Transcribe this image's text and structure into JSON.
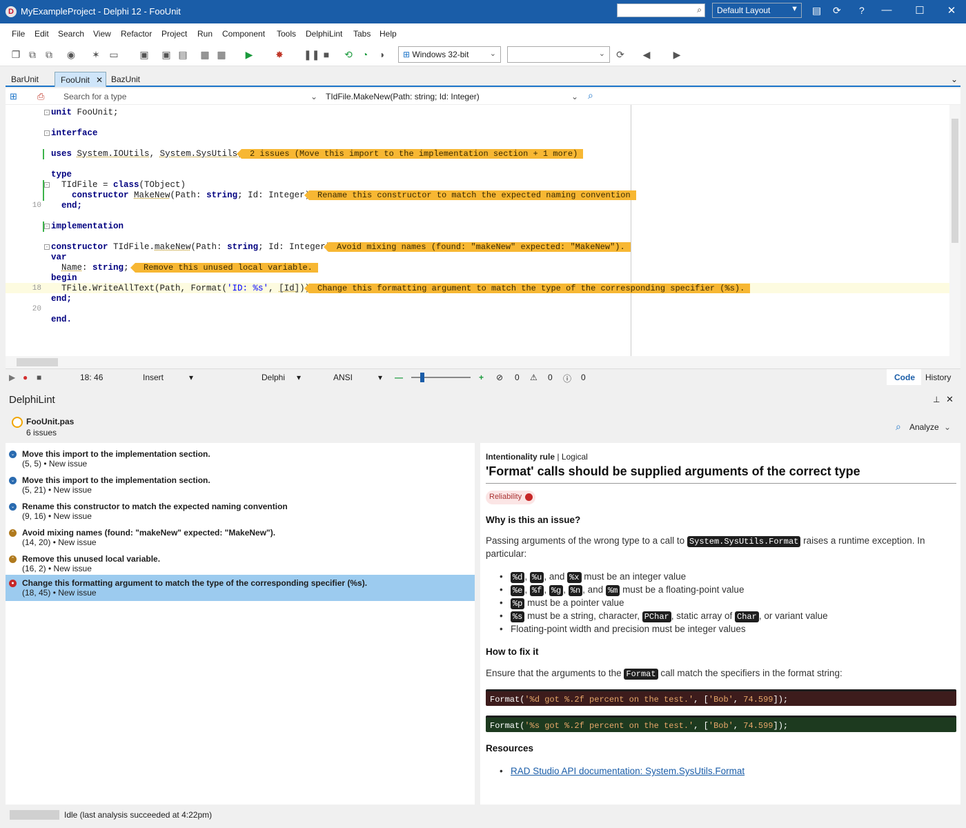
{
  "window": {
    "title": "MyExampleProject - Delphi 12 - FooUnit",
    "layout": "Default Layout",
    "help_label": "?"
  },
  "menu": [
    "File",
    "Edit",
    "Search",
    "View",
    "Refactor",
    "Project",
    "Run",
    "Component",
    "Tools",
    "DelphiLint",
    "Tabs",
    "Help"
  ],
  "toolbar": {
    "platform": "Windows 32-bit",
    "config": ""
  },
  "tabs": [
    "BarUnit",
    "FooUnit",
    "BazUnit"
  ],
  "editor_header": {
    "search_placeholder": "Search for a type",
    "method": "TIdFile.MakeNew(Path: string; Id: Integer)"
  },
  "code": {
    "l1_kw": "unit",
    "l1_rest": " FooUnit;",
    "l3": "interface",
    "l5_kw": "uses",
    "l5_a": "System.IOUtils",
    "l5_sep": ", ",
    "l5_b": "System.SysUtils",
    "l5_end": ";",
    "l7": "type",
    "l8_a": "  TIdFile = ",
    "l8_kw": "class",
    "l8_b": "(TObject)",
    "l9_kw": "    constructor ",
    "l9_name": "MakeNew",
    "l9_a": "(Path: ",
    "l9_t1": "string",
    "l9_b": "; Id: Integer);",
    "l10": "  end;",
    "l12": "implementation",
    "l14_kw": "constructor",
    "l14_a": " TIdFile.",
    "l14_name": "makeNew",
    "l14_b": "(Path: ",
    "l14_t": "string",
    "l14_c": "; Id: Integer);",
    "l15": "var",
    "l16_a": "  ",
    "l16_name": "Name",
    "l16_b": ": ",
    "l16_t": "string",
    "l16_c": ";",
    "l17": "begin",
    "l18_a": "  TFile.WriteAllText(Path, Format(",
    "l18_s": "'ID: %s'",
    "l18_b": ", ",
    "l18_arr": "[Id]",
    "l18_c": "));",
    "l19": "end;",
    "l21": "end.",
    "ln10": "10",
    "ln18": "18",
    "ln20": "20"
  },
  "inline_issues": {
    "i5": "2 issues (Move this import to the implementation section + 1 more)",
    "i9": "Rename this constructor to match the expected naming convention",
    "i14": "Avoid mixing names (found: \"makeNew\" expected: \"MakeNew\").",
    "i16": "Remove this unused local variable.",
    "i18": "Change this formatting argument to match the type of the corresponding specifier (%s)."
  },
  "status": {
    "position": "18: 46",
    "mode": "Insert",
    "language": "Delphi",
    "encoding": "ANSI",
    "errors": "0",
    "warnings": "0",
    "hints": "0",
    "code_tab": "Code",
    "history_tab": "History"
  },
  "lint": {
    "panel_title": "DelphiLint",
    "file": "FooUnit.pas",
    "count": "6 issues",
    "analyze": "Analyze",
    "issues": [
      {
        "title": "Move this import to the implementation section.",
        "meta": "(5, 5) • New issue",
        "sev": "info"
      },
      {
        "title": "Move this import to the implementation section.",
        "meta": "(5, 21) • New issue",
        "sev": "info"
      },
      {
        "title": "Rename this constructor to match the expected naming convention",
        "meta": "(9, 16) • New issue",
        "sev": "info"
      },
      {
        "title": "Avoid mixing names (found: \"makeNew\" expected: \"MakeNew\").",
        "meta": "(14, 20) • New issue",
        "sev": "minor"
      },
      {
        "title": "Remove this unused local variable.",
        "meta": "(16, 2) • New issue",
        "sev": "minor"
      },
      {
        "title": "Change this formatting argument to match the type of the corresponding specifier (%s).",
        "meta": "(18, 45) • New issue",
        "sev": "critical"
      }
    ],
    "status": "Idle (last analysis succeeded at 4:22pm)"
  },
  "detail": {
    "rule_type": "Intentionality rule",
    "rule_cat": "Logical",
    "title": "'Format' calls should be supplied arguments of the correct type",
    "badge": "Reliability",
    "why_heading": "Why is this an issue?",
    "why_1": "Passing arguments of the wrong type to a call to",
    "why_code": "System.SysUtils.Format",
    "why_2": " raises a runtime exception. In",
    "why_3": "particular:",
    "b1_c1": "%d",
    "b1_c2": "%u",
    "b1_c3": "%x",
    "b1_txt": " must be an integer value",
    "b2_c1": "%e",
    "b2_c2": "%f",
    "b2_c3": "%g",
    "b2_c4": "%n",
    "b2_c5": "%m",
    "b2_txt": " must be a floating-point value",
    "b3_c1": "%p",
    "b3_txt": " must be a pointer value",
    "b4_c1": "%s",
    "b4_txt1": " must be a string, character, ",
    "b4_c2": "PChar",
    "b4_txt2": ", static array of ",
    "b4_c3": "Char",
    "b4_txt3": ", or variant value",
    "b5": "Floating-point width and precision must be integer values",
    "sep_comma": ", ",
    "sep_and": ", and ",
    "fix_heading": "How to fix it",
    "fix_1": "Ensure that the arguments to the ",
    "fix_code": "Format",
    "fix_2": " call match the specifiers in the format string:",
    "bad_a": "Format(",
    "bad_s": "'%d got %.2f percent on the test.'",
    "bad_b": ", [",
    "bad_s2": "'Bob'",
    "bad_c": ", ",
    "bad_n": "74.599",
    "bad_d": "]);",
    "good_a": "Format(",
    "good_s": "'%s got %.2f percent on the test.'",
    "good_b": ", [",
    "good_s2": "'Bob'",
    "good_c": ", ",
    "good_n": "74.599",
    "good_d": "]);",
    "res_heading": "Resources",
    "res_link": "RAD Studio API documentation: System.SysUtils.Format"
  }
}
